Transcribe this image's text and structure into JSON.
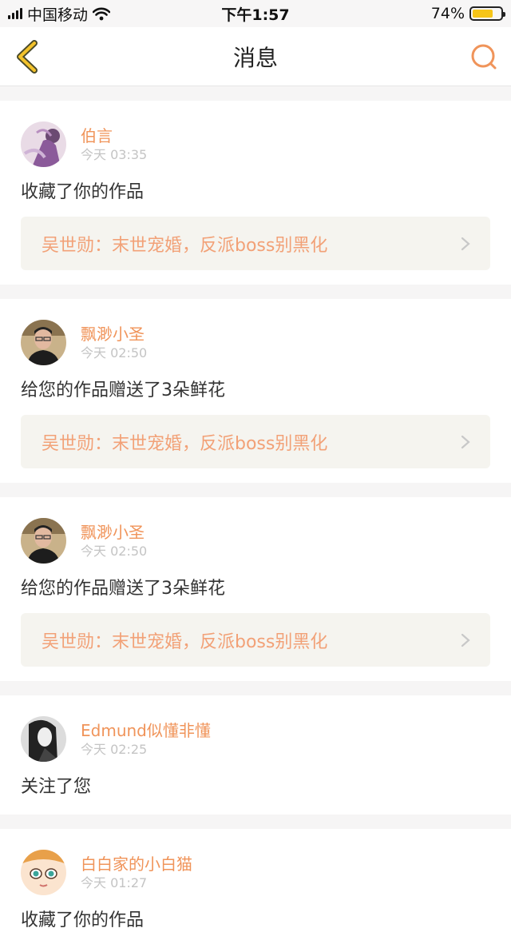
{
  "status": {
    "carrier": "中国移动",
    "time": "下午1:57",
    "battery": "74%",
    "battery_level": 0.74
  },
  "header": {
    "title": "消息"
  },
  "messages": [
    {
      "user": "伯言",
      "time": "今天 03:35",
      "action": "收藏了你的作品",
      "work": "吴世勋：末世宠婚，反派boss别黑化"
    },
    {
      "user": "飘渺小圣",
      "time": "今天 02:50",
      "action": "给您的作品赠送了3朵鲜花",
      "work": "吴世勋：末世宠婚，反派boss别黑化"
    },
    {
      "user": "飘渺小圣",
      "time": "今天 02:50",
      "action": "给您的作品赠送了3朵鲜花",
      "work": "吴世勋：末世宠婚，反派boss别黑化"
    },
    {
      "user": "Edmund似懂非懂",
      "time": "今天 02:25",
      "action": "关注了您"
    },
    {
      "user": "白白家的小白猫",
      "time": "今天 01:27",
      "action": "收藏了你的作品"
    }
  ],
  "colors": {
    "accent": "#f0945a",
    "work_text": "#f2a177",
    "back_icon": "#f3c22b"
  }
}
